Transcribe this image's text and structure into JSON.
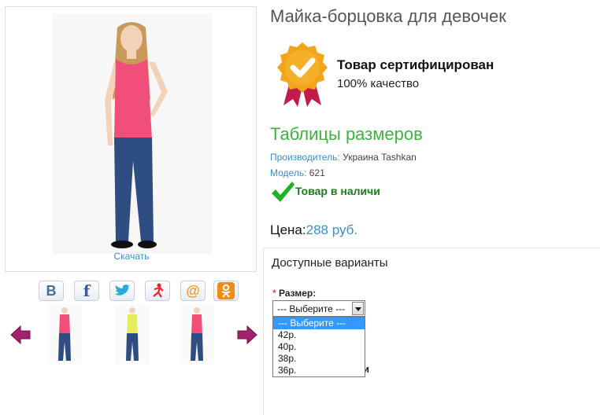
{
  "product": {
    "title": "Майка-борцовка для девочек",
    "download_label": "Скачать",
    "certificate": {
      "title": "Товар сертифицирован",
      "subtitle": "100% качество"
    },
    "size_table_link": "Таблицы размеров",
    "manufacturer_label": "Производитель:",
    "manufacturer_value": "Украина Tashkan",
    "model_label": "Модель:",
    "model_value": "621",
    "stock_text": "Товар в наличи",
    "price_label": "Цена:",
    "price_value": "288 руб."
  },
  "social": [
    "В",
    "f",
    "twitter",
    "ok-man",
    "@",
    "ок"
  ],
  "thumbnails": [
    {
      "top_color": "#f24e7a",
      "pants_color": "#2d4a7a"
    },
    {
      "top_color": "#e5ee5a",
      "pants_color": "#2d4a7a"
    },
    {
      "top_color": "#f24e7a",
      "pants_color": "#2d4a7a"
    }
  ],
  "variants": {
    "title": "Доступные варианты",
    "required_mark": "*",
    "size_label": "Размер:",
    "selected": "--- Выберите ---",
    "options": [
      "--- Выберите ---",
      "42р.",
      "40р.",
      "38р.",
      "36р."
    ],
    "hidden_tail": "и"
  },
  "colors": {
    "accent_blue": "#3a8fcb",
    "accent_green": "#3cb53c",
    "arrow_purple": "#a0226e",
    "badge_gold": "#f2a51a",
    "ribbon_red": "#c41c4a"
  }
}
